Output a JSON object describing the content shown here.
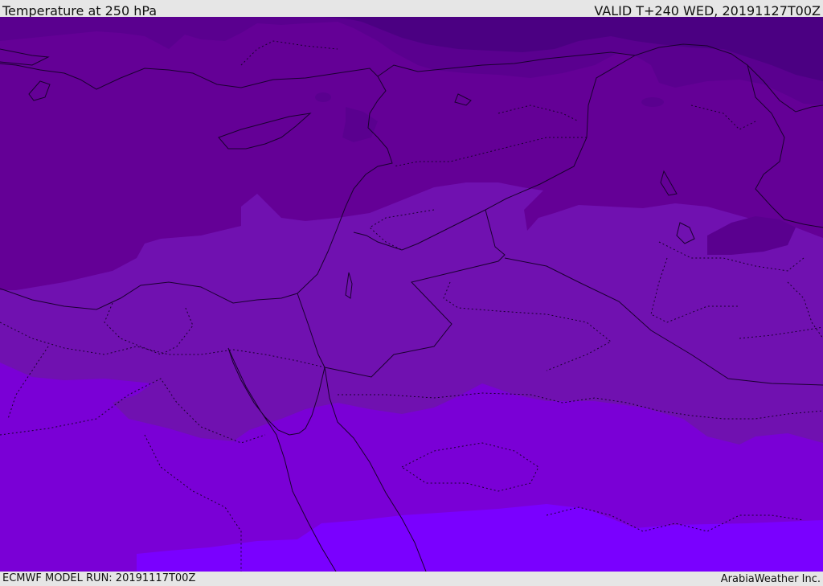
{
  "header": {
    "title": "Temperature at 250 hPa",
    "valid_time": "VALID T+240 WED, 20191127T00Z"
  },
  "footer": {
    "model_run": "ECMWF MODEL RUN: 20191117T00Z",
    "credit": "ArabiaWeather Inc."
  },
  "map": {
    "type": "filled-contour",
    "field": "temperature",
    "level": "250 hPa",
    "colors": {
      "band_coldest": "#4b0082",
      "band_2": "#5a008f",
      "band_3": "#640096",
      "band_4": "#7011b0",
      "band_5": "#7a00d6",
      "band_warmest": "#7a00ff",
      "coastline": "#1a0030",
      "border_dotted": "#1a0030"
    }
  }
}
